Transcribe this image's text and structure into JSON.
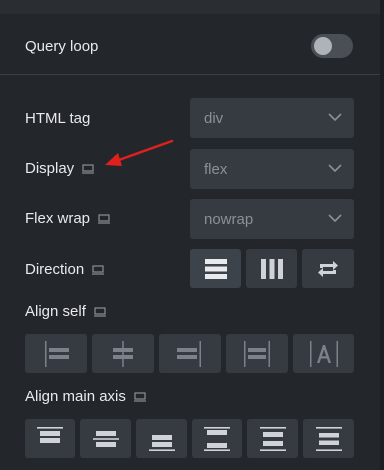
{
  "query_loop": {
    "label": "Query loop",
    "enabled": false
  },
  "html_tag": {
    "label": "HTML tag",
    "value": "div"
  },
  "display": {
    "label": "Display",
    "value": "flex"
  },
  "flex_wrap": {
    "label": "Flex wrap",
    "value": "nowrap"
  },
  "direction": {
    "label": "Direction",
    "options": [
      "column-icon",
      "row-icon",
      "reverse-icon"
    ]
  },
  "align_self": {
    "label": "Align self",
    "options": [
      "align-self-start-icon",
      "align-self-center-icon",
      "align-self-end-icon",
      "align-self-stretch-icon",
      "align-self-baseline-icon"
    ]
  },
  "align_main_axis": {
    "label": "Align main axis",
    "options": [
      "justify-start-icon",
      "justify-center-icon",
      "justify-end-icon",
      "justify-space-between-icon",
      "justify-space-around-icon",
      "justify-space-evenly-icon"
    ]
  },
  "colors": {
    "background": "#23272c",
    "control": "#363b42",
    "icon": "#cfd3d8",
    "icon_dim": "#7c828a",
    "annotation_arrow": "#e0201c"
  }
}
